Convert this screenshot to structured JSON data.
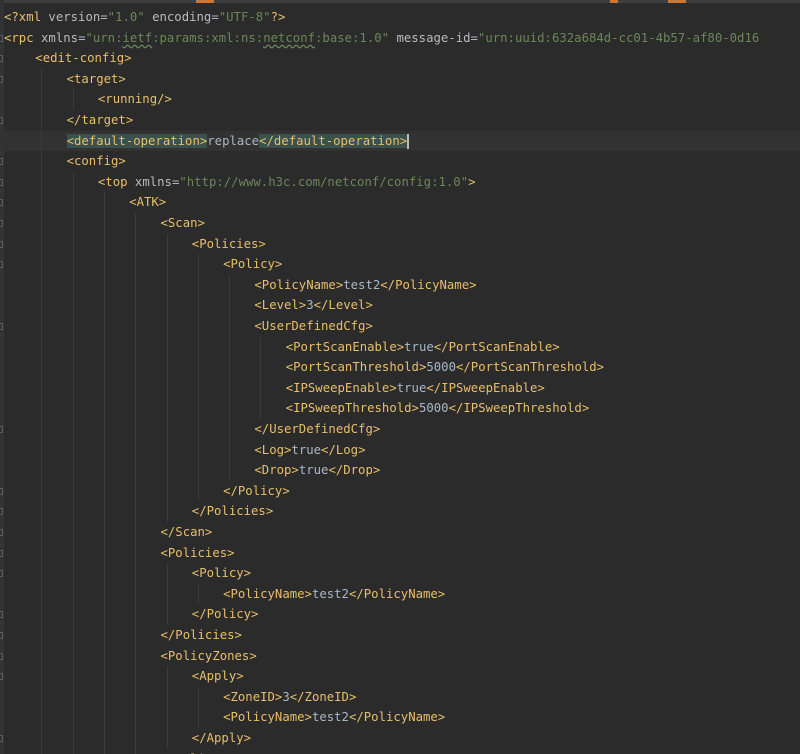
{
  "editor": {
    "language": "XML",
    "caret_line": 7,
    "lines": [
      {
        "indent": 0,
        "tokens": [
          {
            "t": "decl",
            "v": "<?xml "
          },
          {
            "t": "attr",
            "v": "version"
          },
          {
            "t": "text",
            "v": "="
          },
          {
            "t": "val",
            "v": "\"1.0\""
          },
          {
            "t": "text",
            "v": " "
          },
          {
            "t": "attr",
            "v": "encoding"
          },
          {
            "t": "text",
            "v": "="
          },
          {
            "t": "val",
            "v": "\"UTF-8\""
          },
          {
            "t": "decl",
            "v": "?>"
          }
        ]
      },
      {
        "indent": 0,
        "tokens": [
          {
            "t": "tag",
            "v": "<rpc "
          },
          {
            "t": "attr",
            "v": "xmlns"
          },
          {
            "t": "text",
            "v": "="
          },
          {
            "t": "val",
            "v": "\"urn:"
          },
          {
            "t": "valsq",
            "v": "ietf"
          },
          {
            "t": "val",
            "v": ":params:xml:ns:"
          },
          {
            "t": "valsq",
            "v": "netconf"
          },
          {
            "t": "val",
            "v": ":base:1.0\""
          },
          {
            "t": "text",
            "v": " "
          },
          {
            "t": "attr",
            "v": "message-id"
          },
          {
            "t": "text",
            "v": "="
          },
          {
            "t": "val",
            "v": "\"urn:uuid:632a684d-cc01-4b57-af80-0d16"
          }
        ]
      },
      {
        "indent": 1,
        "tokens": [
          {
            "t": "tag",
            "v": "<edit-config>"
          }
        ]
      },
      {
        "indent": 2,
        "tokens": [
          {
            "t": "tag",
            "v": "<target>"
          }
        ]
      },
      {
        "indent": 3,
        "tokens": [
          {
            "t": "tag",
            "v": "<running/>"
          }
        ]
      },
      {
        "indent": 2,
        "tokens": [
          {
            "t": "tag",
            "v": "</target>"
          }
        ]
      },
      {
        "indent": 2,
        "tokens": [
          {
            "t": "tagm",
            "v": "<default-operation>"
          },
          {
            "t": "text",
            "v": "replace"
          },
          {
            "t": "tagm",
            "v": "</default-operation>"
          },
          {
            "t": "caret",
            "v": ""
          }
        ]
      },
      {
        "indent": 2,
        "tokens": [
          {
            "t": "tag",
            "v": "<config>"
          }
        ]
      },
      {
        "indent": 3,
        "tokens": [
          {
            "t": "tag",
            "v": "<top "
          },
          {
            "t": "attr",
            "v": "xmlns"
          },
          {
            "t": "text",
            "v": "="
          },
          {
            "t": "val",
            "v": "\"http://www.h3c.com/netconf/config:1.0\""
          },
          {
            "t": "tag",
            "v": ">"
          }
        ]
      },
      {
        "indent": 4,
        "tokens": [
          {
            "t": "tag",
            "v": "<ATK>"
          }
        ]
      },
      {
        "indent": 5,
        "tokens": [
          {
            "t": "tag",
            "v": "<Scan>"
          }
        ]
      },
      {
        "indent": 6,
        "tokens": [
          {
            "t": "tag",
            "v": "<Policies>"
          }
        ]
      },
      {
        "indent": 7,
        "tokens": [
          {
            "t": "tag",
            "v": "<Policy>"
          }
        ]
      },
      {
        "indent": 8,
        "tokens": [
          {
            "t": "tag",
            "v": "<PolicyName>"
          },
          {
            "t": "text",
            "v": "test2"
          },
          {
            "t": "tag",
            "v": "</PolicyName>"
          }
        ]
      },
      {
        "indent": 8,
        "tokens": [
          {
            "t": "tag",
            "v": "<Level>"
          },
          {
            "t": "text",
            "v": "3"
          },
          {
            "t": "tag",
            "v": "</Level>"
          }
        ]
      },
      {
        "indent": 8,
        "tokens": [
          {
            "t": "tag",
            "v": "<UserDefinedCfg>"
          }
        ]
      },
      {
        "indent": 9,
        "tokens": [
          {
            "t": "tag",
            "v": "<PortScanEnable>"
          },
          {
            "t": "text",
            "v": "true"
          },
          {
            "t": "tag",
            "v": "</PortScanEnable>"
          }
        ]
      },
      {
        "indent": 9,
        "tokens": [
          {
            "t": "tag",
            "v": "<PortScanThreshold>"
          },
          {
            "t": "text",
            "v": "5000"
          },
          {
            "t": "tag",
            "v": "</PortScanThreshold>"
          }
        ]
      },
      {
        "indent": 9,
        "tokens": [
          {
            "t": "tag",
            "v": "<IPSweepEnable>"
          },
          {
            "t": "text",
            "v": "true"
          },
          {
            "t": "tag",
            "v": "</IPSweepEnable>"
          }
        ]
      },
      {
        "indent": 9,
        "tokens": [
          {
            "t": "tag",
            "v": "<IPSweepThreshold>"
          },
          {
            "t": "text",
            "v": "5000"
          },
          {
            "t": "tag",
            "v": "</IPSweepThreshold>"
          }
        ]
      },
      {
        "indent": 8,
        "tokens": [
          {
            "t": "tag",
            "v": "</UserDefinedCfg>"
          }
        ]
      },
      {
        "indent": 8,
        "tokens": [
          {
            "t": "tag",
            "v": "<Log>"
          },
          {
            "t": "text",
            "v": "true"
          },
          {
            "t": "tag",
            "v": "</Log>"
          }
        ]
      },
      {
        "indent": 8,
        "tokens": [
          {
            "t": "tag",
            "v": "<Drop>"
          },
          {
            "t": "text",
            "v": "true"
          },
          {
            "t": "tag",
            "v": "</Drop>"
          }
        ]
      },
      {
        "indent": 7,
        "tokens": [
          {
            "t": "tag",
            "v": "</Policy>"
          }
        ]
      },
      {
        "indent": 6,
        "tokens": [
          {
            "t": "tag",
            "v": "</Policies>"
          }
        ]
      },
      {
        "indent": 5,
        "tokens": [
          {
            "t": "tag",
            "v": "</Scan>"
          }
        ]
      },
      {
        "indent": 5,
        "tokens": [
          {
            "t": "tag",
            "v": "<Policies>"
          }
        ]
      },
      {
        "indent": 6,
        "tokens": [
          {
            "t": "tag",
            "v": "<Policy>"
          }
        ]
      },
      {
        "indent": 7,
        "tokens": [
          {
            "t": "tag",
            "v": "<PolicyName>"
          },
          {
            "t": "text",
            "v": "test2"
          },
          {
            "t": "tag",
            "v": "</PolicyName>"
          }
        ]
      },
      {
        "indent": 6,
        "tokens": [
          {
            "t": "tag",
            "v": "</Policy>"
          }
        ]
      },
      {
        "indent": 5,
        "tokens": [
          {
            "t": "tag",
            "v": "</Policies>"
          }
        ]
      },
      {
        "indent": 5,
        "tokens": [
          {
            "t": "tag",
            "v": "<PolicyZones>"
          }
        ]
      },
      {
        "indent": 6,
        "tokens": [
          {
            "t": "tag",
            "v": "<Apply>"
          }
        ]
      },
      {
        "indent": 7,
        "tokens": [
          {
            "t": "tag",
            "v": "<ZoneID>"
          },
          {
            "t": "text",
            "v": "3"
          },
          {
            "t": "tag",
            "v": "</ZoneID>"
          }
        ]
      },
      {
        "indent": 7,
        "tokens": [
          {
            "t": "tag",
            "v": "<PolicyName>"
          },
          {
            "t": "text",
            "v": "test2"
          },
          {
            "t": "tag",
            "v": "</PolicyName>"
          }
        ]
      },
      {
        "indent": 6,
        "tokens": [
          {
            "t": "tag",
            "v": "</Apply>"
          }
        ]
      },
      {
        "indent": 5,
        "tokens": [
          {
            "t": "tag",
            "v": "</PolicyZones>"
          }
        ]
      }
    ]
  }
}
